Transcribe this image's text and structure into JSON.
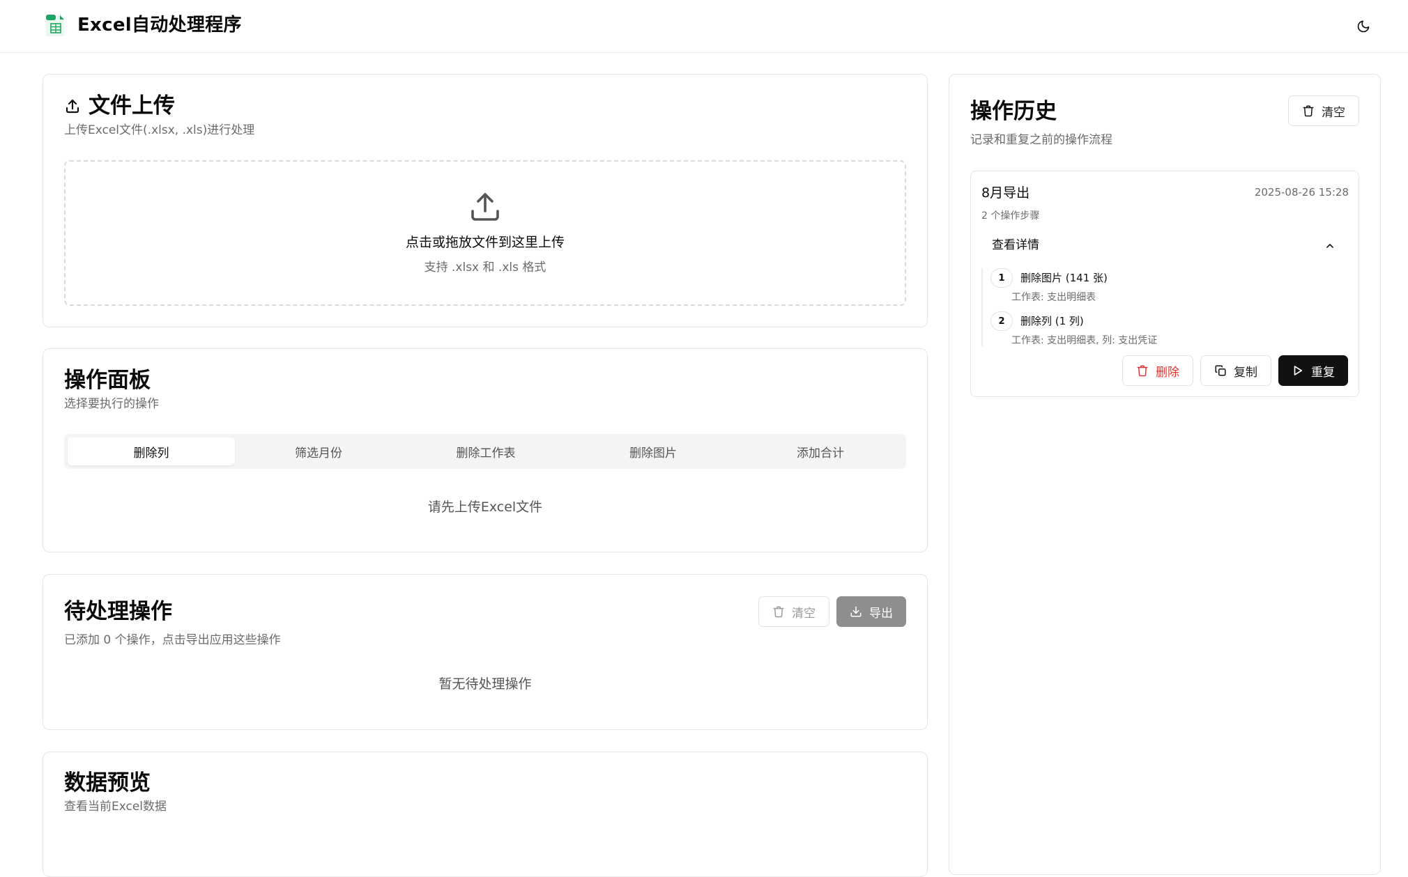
{
  "app": {
    "title": "Excel自动处理程序",
    "logo_icon": "excel-sheet-icon",
    "theme_icon": "moon-icon"
  },
  "upload": {
    "title": "文件上传",
    "description": "上传Excel文件(.xlsx, .xls)进行处理",
    "drop_text": "点击或拖放文件到这里上传",
    "formats_text": "支持 .xlsx 和 .xls 格式"
  },
  "panel": {
    "title": "操作面板",
    "description": "选择要执行的操作",
    "tabs": [
      {
        "label": "删除列",
        "active": true
      },
      {
        "label": "筛选月份",
        "active": false
      },
      {
        "label": "删除工作表",
        "active": false
      },
      {
        "label": "删除图片",
        "active": false
      },
      {
        "label": "添加合计",
        "active": false
      }
    ],
    "empty_text": "请先上传Excel文件"
  },
  "pending": {
    "title": "待处理操作",
    "description": "已添加 0 个操作，点击导出应用这些操作",
    "clear_label": "清空",
    "export_label": "导出",
    "empty_text": "暂无待处理操作"
  },
  "preview": {
    "title": "数据预览",
    "description": "查看当前Excel数据"
  },
  "history": {
    "title": "操作历史",
    "description": "记录和重复之前的操作流程",
    "clear_label": "清空",
    "items": [
      {
        "name": "8月导出",
        "timestamp": "2025-08-26 15:28",
        "step_count_text": "2 个操作步骤",
        "details_label": "查看详情",
        "steps": [
          {
            "num": "1",
            "title": "删除图片 (141 张)",
            "sub": "工作表: 支出明细表"
          },
          {
            "num": "2",
            "title": "删除列 (1 列)",
            "sub": "工作表: 支出明细表, 列: 支出凭证"
          }
        ],
        "delete_label": "删除",
        "copy_label": "复制",
        "replay_label": "重复"
      }
    ]
  },
  "colors": {
    "accent_dark": "#111111",
    "danger": "#e03434",
    "excel_green": "#21a366"
  }
}
